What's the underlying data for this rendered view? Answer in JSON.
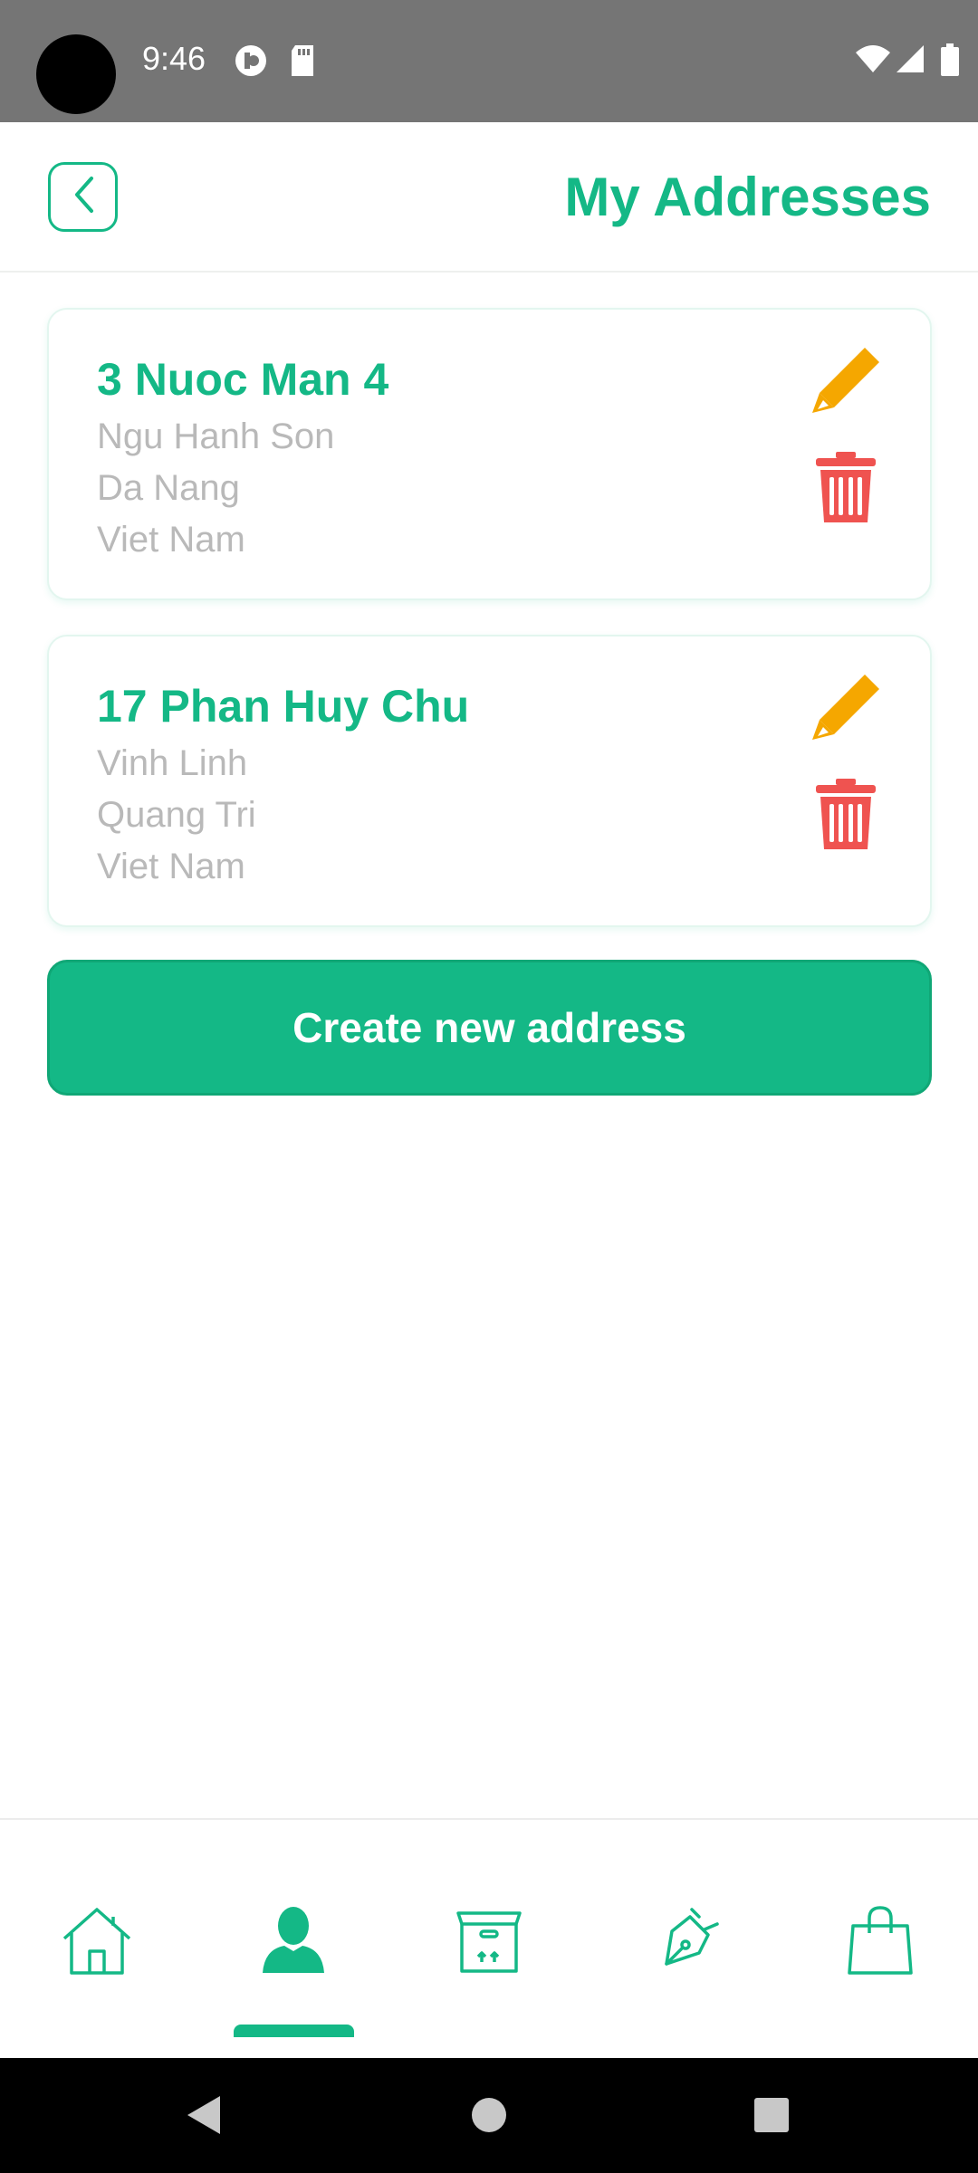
{
  "status_bar": {
    "time": "9:46",
    "icons": [
      "vpn-key-icon",
      "sd-card-icon",
      "wifi-icon",
      "signal-icon",
      "battery-icon"
    ]
  },
  "header": {
    "title": "My Addresses",
    "back_icon": "chevron-left-icon"
  },
  "addresses": [
    {
      "street": "3 Nuoc Man 4",
      "district": "Ngu Hanh Son",
      "city": "Da Nang",
      "country": "Viet Nam"
    },
    {
      "street": "17 Phan Huy Chu",
      "district": "Vinh Linh",
      "city": "Quang Tri",
      "country": "Viet Nam"
    }
  ],
  "actions": {
    "create_label": "Create new address",
    "edit_icon": "pencil-icon",
    "delete_icon": "trash-icon"
  },
  "bottom_nav": {
    "items": [
      "home-icon",
      "profile-icon",
      "package-icon",
      "pen-icon",
      "shopping-bag-icon"
    ],
    "active_index": 1
  },
  "colors": {
    "accent": "#14b886",
    "edit": "#f5a700",
    "delete": "#ef5350",
    "secondary_text": "#b9b9b9"
  }
}
